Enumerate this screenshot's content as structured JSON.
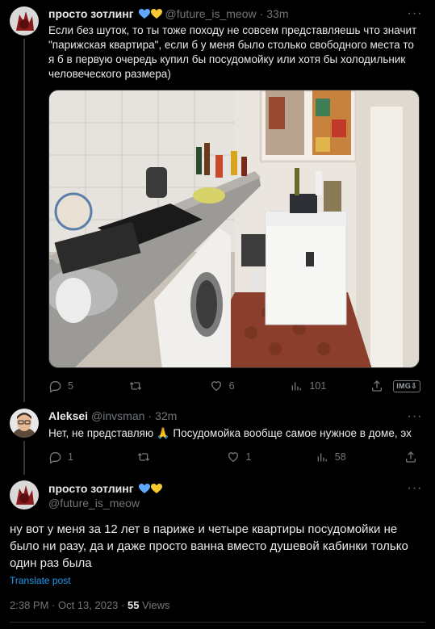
{
  "tweet1": {
    "display_name": "просто зотлинг",
    "handle": "@future_is_meow",
    "time": "33m",
    "text": "Если без шуток, то ты тоже походу не совсем представляешь что значит \"парижская квартира\", если б у меня было столько свободного места то я б в первую очередь купил бы посудомойку или хотя бы холодильник человеческого размера)",
    "replies": "5",
    "retweets": "",
    "likes": "6",
    "views": "101",
    "img_badge": "IMG⇩"
  },
  "tweet2": {
    "display_name": "Aleksei",
    "handle": "@invsman",
    "time": "32m",
    "text": "Нет, не представляю 🙏 Посудомойка вообще самое нужное в доме, эх",
    "replies": "1",
    "retweets": "",
    "likes": "1",
    "views": "58"
  },
  "tweet3": {
    "display_name": "просто зотлинг",
    "handle": "@future_is_meow",
    "text": "ну вот у меня за 12 лет в париже и четыре квартиры посудомойки не было ни разу, да и даже просто ванна вместо душевой кабинки только один раз была",
    "translate": "Translate post",
    "timestamp": "2:38 PM · Oct 13, 2023 · ",
    "views_count": "55",
    "views_label": " Views"
  },
  "colors": {
    "background": "#000000",
    "text": "#e7e9ea",
    "muted": "#71767b",
    "link": "#1d9bf0",
    "heart_blue": "#5fa8ff",
    "heart_yellow": "#f5c932"
  }
}
